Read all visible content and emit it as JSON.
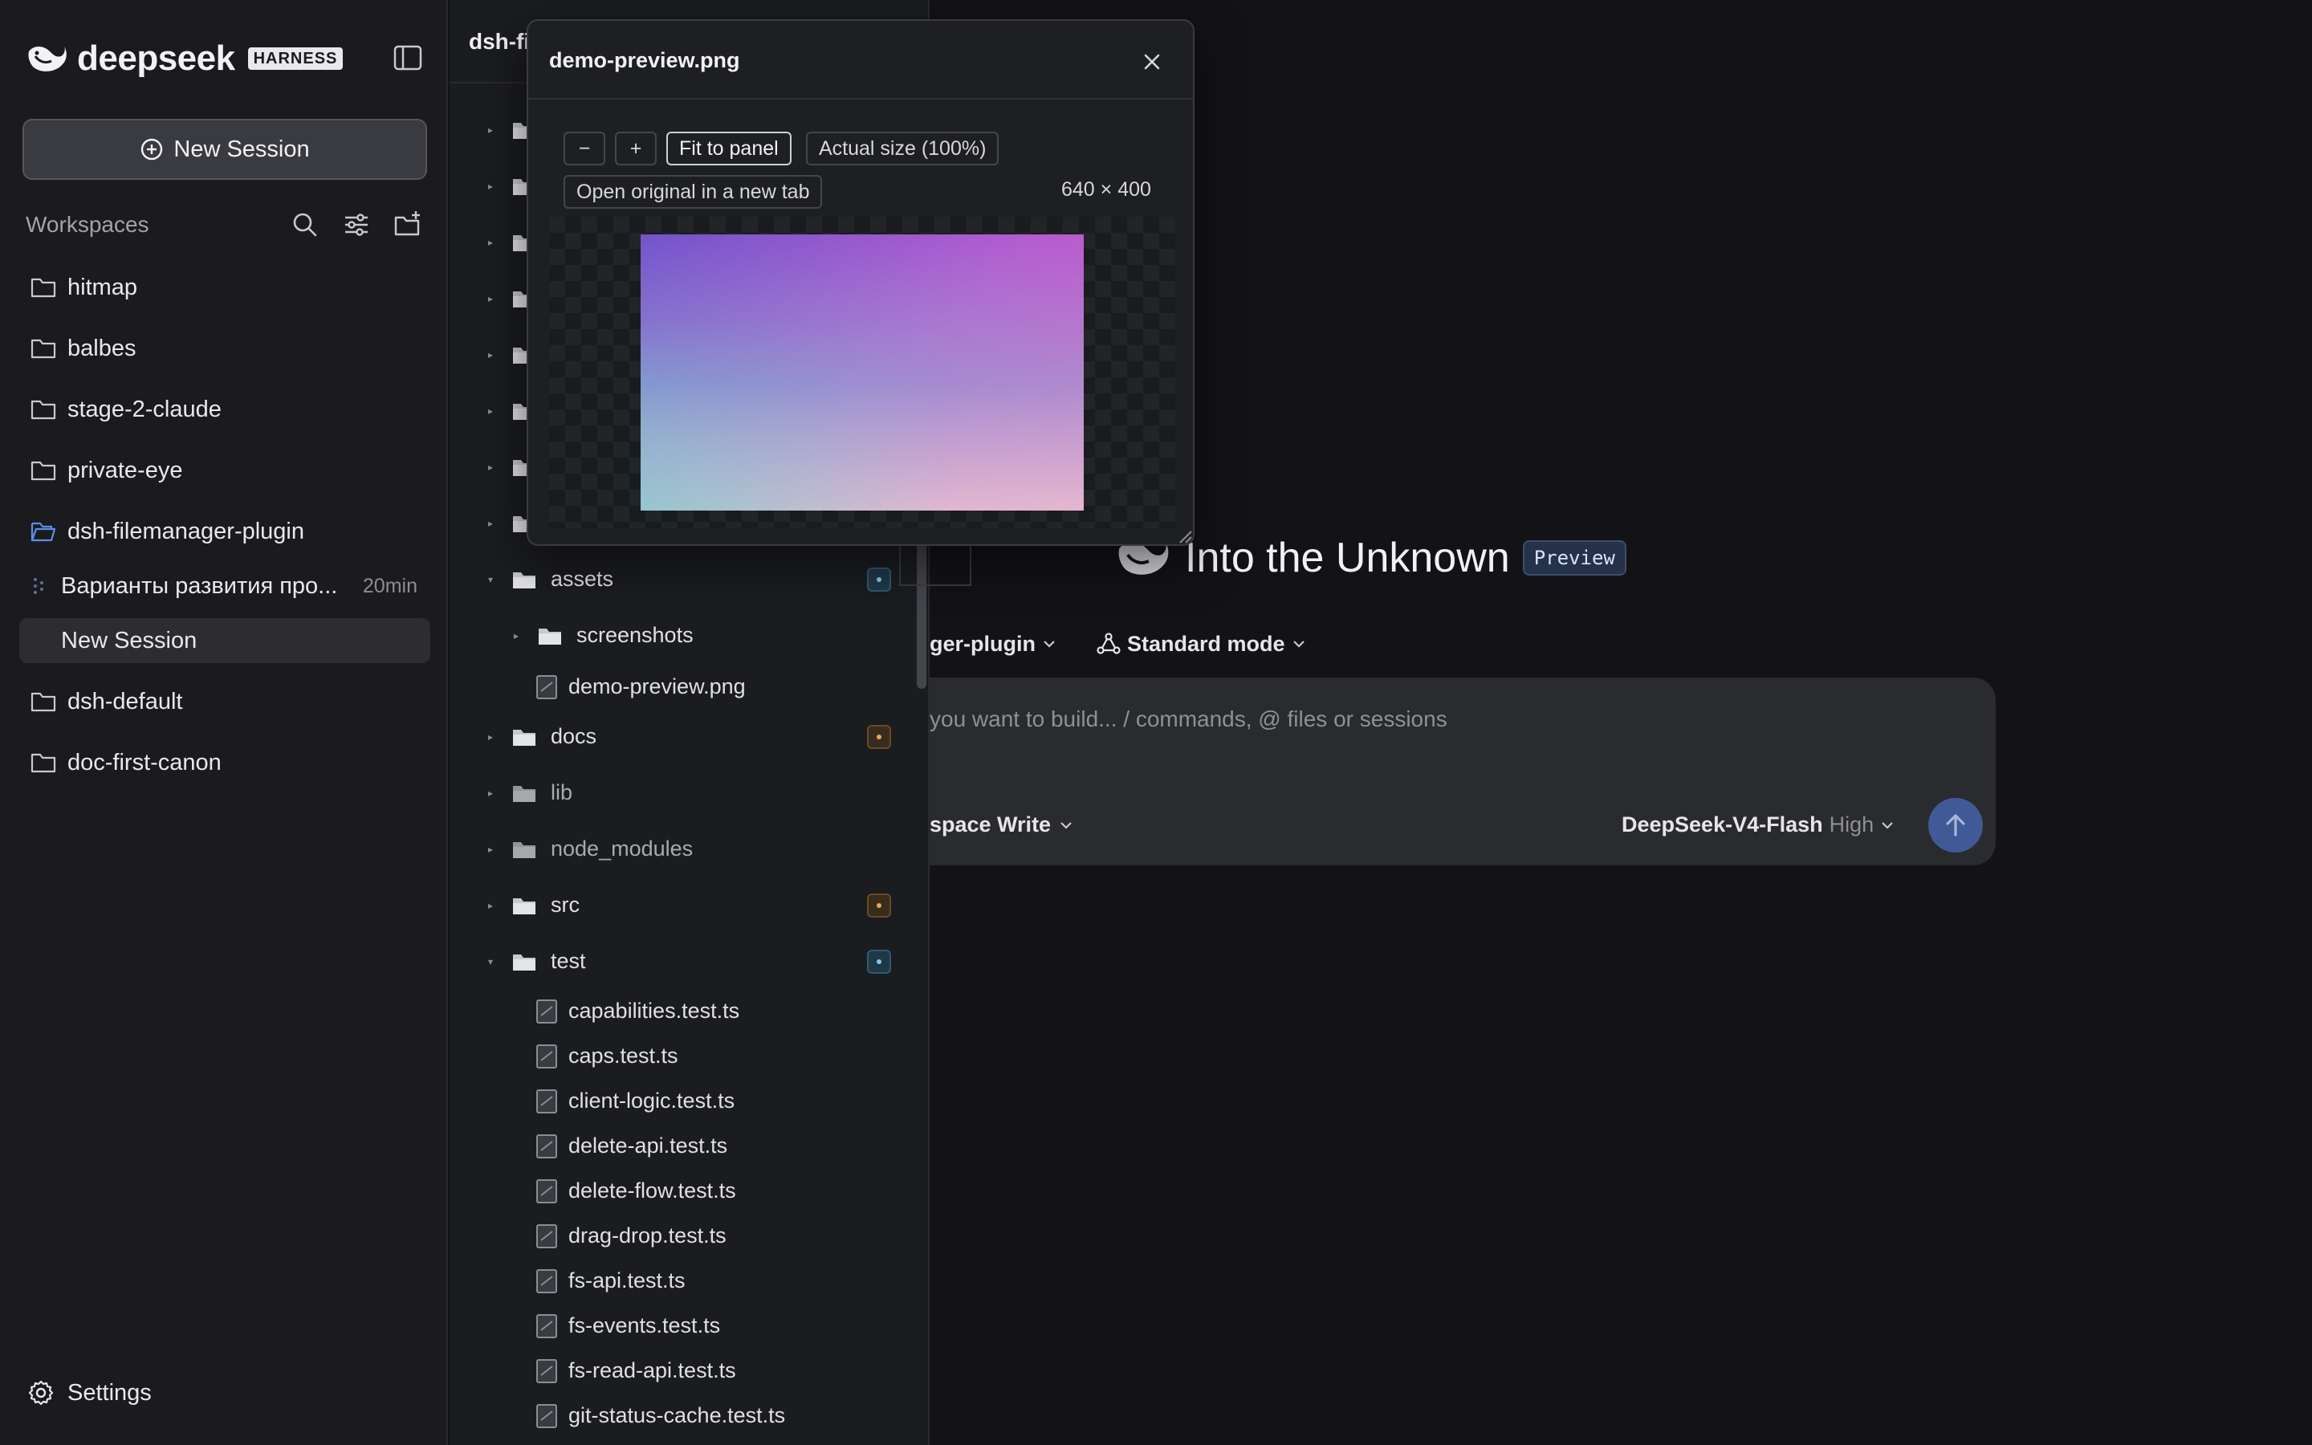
{
  "sidebar": {
    "brand_name": "deepseek",
    "brand_badge": "HARNESS",
    "new_session_label": "New Session",
    "workspaces_title": "Workspaces",
    "workspaces": [
      {
        "label": "hitmap",
        "open": false
      },
      {
        "label": "balbes",
        "open": false
      },
      {
        "label": "stage-2-claude",
        "open": false
      },
      {
        "label": "private-eye",
        "open": false
      },
      {
        "label": "dsh-filemanager-plugin",
        "open": true
      },
      {
        "label": "dsh-default",
        "open": false
      },
      {
        "label": "doc-first-canon",
        "open": false
      }
    ],
    "sessions": [
      {
        "label": "Варианты развития про...",
        "meta": "20min"
      },
      {
        "label": "New Session",
        "meta": ""
      }
    ],
    "settings_label": "Settings",
    "accent_color": "#5b8def"
  },
  "file_panel": {
    "header": "dsh-fi",
    "tree": [
      {
        "label": "assets",
        "type": "folder",
        "expanded": true,
        "status": "blue"
      },
      {
        "label": "screenshots",
        "type": "folder",
        "expanded": false,
        "status": ""
      },
      {
        "label": "demo-preview.png",
        "type": "file",
        "status": ""
      },
      {
        "label": "docs",
        "type": "folder",
        "expanded": false,
        "status": "orange"
      },
      {
        "label": "lib",
        "type": "folder",
        "expanded": false,
        "status": ""
      },
      {
        "label": "node_modules",
        "type": "folder",
        "expanded": false,
        "status": ""
      },
      {
        "label": "src",
        "type": "folder",
        "expanded": false,
        "status": "orange"
      },
      {
        "label": "test",
        "type": "folder",
        "expanded": true,
        "status": "blue"
      },
      {
        "label": "capabilities.test.ts",
        "type": "file",
        "status": ""
      },
      {
        "label": "caps.test.ts",
        "type": "file",
        "status": ""
      },
      {
        "label": "client-logic.test.ts",
        "type": "file",
        "status": ""
      },
      {
        "label": "delete-api.test.ts",
        "type": "file",
        "status": ""
      },
      {
        "label": "delete-flow.test.ts",
        "type": "file",
        "status": ""
      },
      {
        "label": "drag-drop.test.ts",
        "type": "file",
        "status": ""
      },
      {
        "label": "fs-api.test.ts",
        "type": "file",
        "status": ""
      },
      {
        "label": "fs-events.test.ts",
        "type": "file",
        "status": ""
      },
      {
        "label": "fs-read-api.test.ts",
        "type": "file",
        "status": ""
      },
      {
        "label": "git-status-cache.test.ts",
        "type": "file",
        "status": ""
      }
    ]
  },
  "preview_popup": {
    "title": "demo-preview.png",
    "zoom_out_label": "−",
    "zoom_in_label": "+",
    "fit_label": "Fit to panel",
    "actual_size_label": "Actual size (100%)",
    "open_original_label": "Open original in a new tab",
    "dimensions": "640 × 400"
  },
  "main": {
    "hero_title": "Into the Unknown",
    "hero_badge": "Preview",
    "workspace_selector": "ger-plugin",
    "mode_selector": "Standard mode",
    "composer_placeholder": " you want to build... / commands, @ files or sessions",
    "permission_selector": "space Write",
    "model_name": "DeepSeek-V4-Flash",
    "model_effort": "High",
    "send_color": "#3f5a96"
  }
}
